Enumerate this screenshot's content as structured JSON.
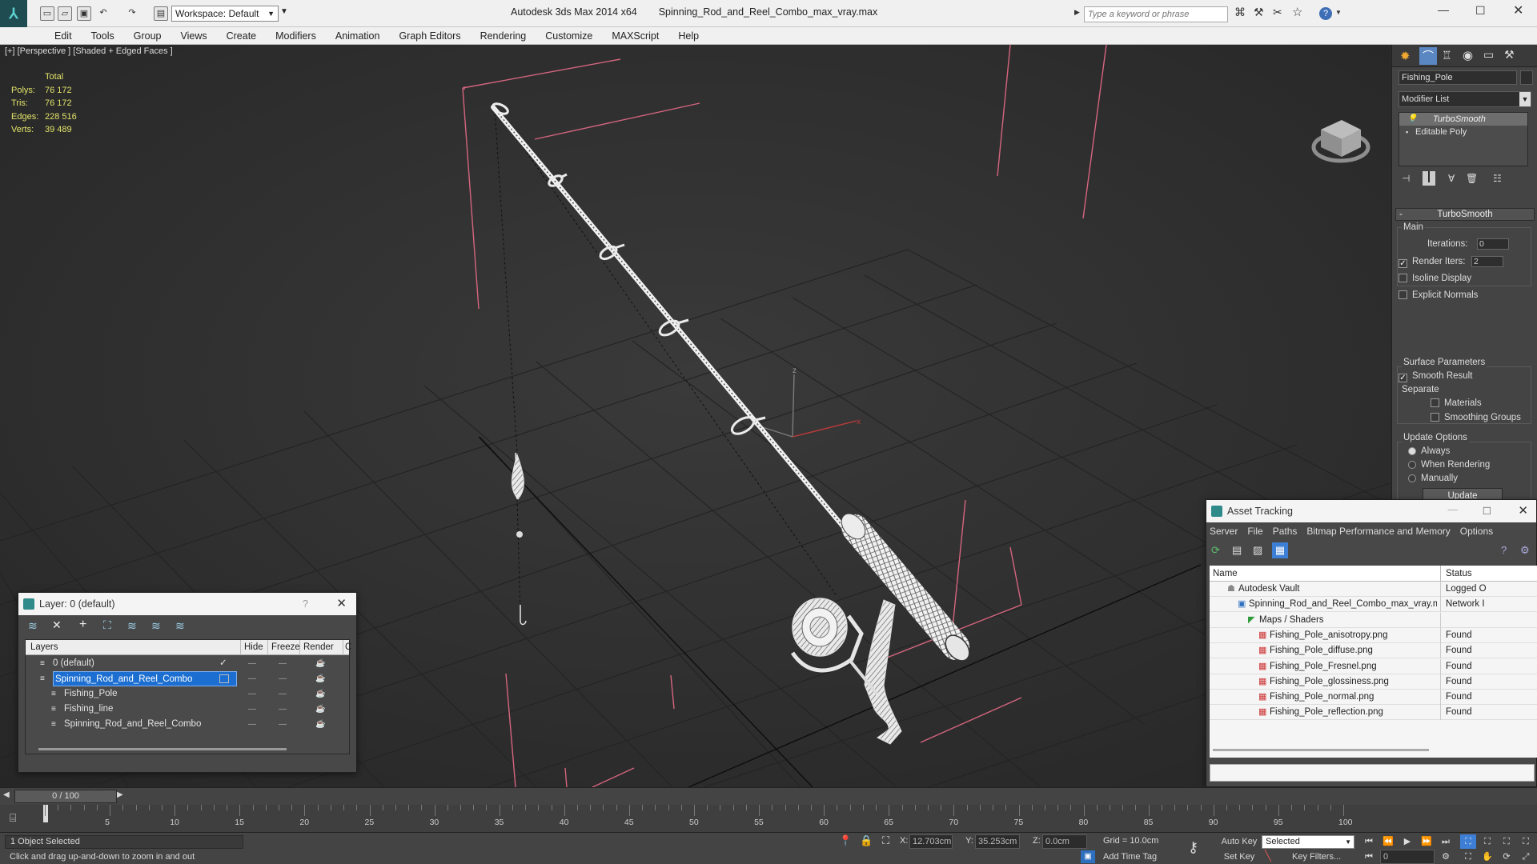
{
  "app": {
    "title_app": "Autodesk 3ds Max  2014 x64",
    "title_file": "Spinning_Rod_and_Reel_Combo_max_vray.max",
    "workspace": "Workspace: Default",
    "search_placeholder": "Type a keyword or phrase"
  },
  "menu": [
    "Edit",
    "Tools",
    "Group",
    "Views",
    "Create",
    "Modifiers",
    "Animation",
    "Graph Editors",
    "Rendering",
    "Customize",
    "MAXScript",
    "Help"
  ],
  "viewport": {
    "label": "[+] [Perspective ] [Shaded + Edged Faces ]",
    "stats_header": "Total",
    "stats": [
      {
        "k": "Polys:",
        "v": "76 172"
      },
      {
        "k": "Tris:",
        "v": "76 172"
      },
      {
        "k": "Edges:",
        "v": "228 516"
      },
      {
        "k": "Verts:",
        "v": "39 489"
      }
    ],
    "axis_x": "x",
    "axis_z": "z"
  },
  "command_panel": {
    "object_name": "Fishing_Pole",
    "modifier_list": "Modifier List",
    "stack": [
      "TurboSmooth",
      "Editable Poly"
    ],
    "rollout_title": "TurboSmooth",
    "main_label": "Main",
    "iterations_label": "Iterations:",
    "iterations_value": "0",
    "render_iters_label": "Render Iters:",
    "render_iters_value": "2",
    "isoline": "Isoline Display",
    "explicit_normals": "Explicit Normals",
    "surface_params": "Surface Parameters",
    "smooth_result": "Smooth Result",
    "separate": "Separate",
    "materials": "Materials",
    "smoothing_groups": "Smoothing Groups",
    "update_options": "Update Options",
    "always": "Always",
    "when_rendering": "When Rendering",
    "manually": "Manually",
    "update_button": "Update"
  },
  "layer_window": {
    "title": "Layer: 0 (default)",
    "help": "?",
    "columns": [
      "Layers",
      "Hide",
      "Freeze",
      "Render",
      "C"
    ],
    "rows": [
      {
        "name": "0 (default)",
        "indent": 0,
        "selected": false,
        "check": "✓"
      },
      {
        "name": "Spinning_Rod_and_Reel_Combo",
        "indent": 0,
        "selected": true,
        "check": ""
      },
      {
        "name": "Fishing_Pole",
        "indent": 1,
        "selected": false,
        "check": ""
      },
      {
        "name": "Fishing_line",
        "indent": 1,
        "selected": false,
        "check": ""
      },
      {
        "name": "Spinning_Rod_and_Reel_Combo",
        "indent": 1,
        "selected": false,
        "check": ""
      }
    ]
  },
  "asset_window": {
    "title": "Asset Tracking",
    "menu": [
      "Server",
      "File",
      "Paths",
      "Bitmap Performance and Memory",
      "Options"
    ],
    "col_name": "Name",
    "col_status": "Status",
    "rows": [
      {
        "name": "Autodesk Vault",
        "status": "Logged O",
        "indent": 0,
        "icon": "vault"
      },
      {
        "name": "Spinning_Rod_and_Reel_Combo_max_vray.max",
        "status": "Network I",
        "indent": 1,
        "icon": "max"
      },
      {
        "name": "Maps / Shaders",
        "status": "",
        "indent": 2,
        "icon": "maps"
      },
      {
        "name": "Fishing_Pole_anisotropy.png",
        "status": "Found",
        "indent": 3,
        "icon": "png"
      },
      {
        "name": "Fishing_Pole_diffuse.png",
        "status": "Found",
        "indent": 3,
        "icon": "png"
      },
      {
        "name": "Fishing_Pole_Fresnel.png",
        "status": "Found",
        "indent": 3,
        "icon": "png"
      },
      {
        "name": "Fishing_Pole_glossiness.png",
        "status": "Found",
        "indent": 3,
        "icon": "png"
      },
      {
        "name": "Fishing_Pole_normal.png",
        "status": "Found",
        "indent": 3,
        "icon": "png"
      },
      {
        "name": "Fishing_Pole_reflection.png",
        "status": "Found",
        "indent": 3,
        "icon": "png"
      }
    ]
  },
  "timeline": {
    "frame": "0 / 100",
    "ticks": [
      "5",
      "10",
      "15",
      "20",
      "25",
      "30",
      "35",
      "40",
      "45",
      "50",
      "55",
      "60",
      "65",
      "70",
      "75",
      "80",
      "85",
      "90",
      "95",
      "100"
    ]
  },
  "status": {
    "selected": "1 Object Selected",
    "prompt": "Click and drag up-and-down to zoom in and out",
    "x_label": "X:",
    "x_value": "12.703cm",
    "y_label": "Y:",
    "y_value": "35.253cm",
    "z_label": "Z:",
    "z_value": "0.0cm",
    "grid": "Grid = 10.0cm",
    "add_time_tag": "Add Time Tag",
    "auto_key": "Auto Key",
    "set_key": "Set Key",
    "selected_dropdown": "Selected",
    "key_filters": "Key Filters...",
    "frame_field": "0"
  },
  "colors": {
    "selection_blue": "#1c6fd1",
    "bounding_box": "#d5657e",
    "wire": "#f2f2f2"
  }
}
